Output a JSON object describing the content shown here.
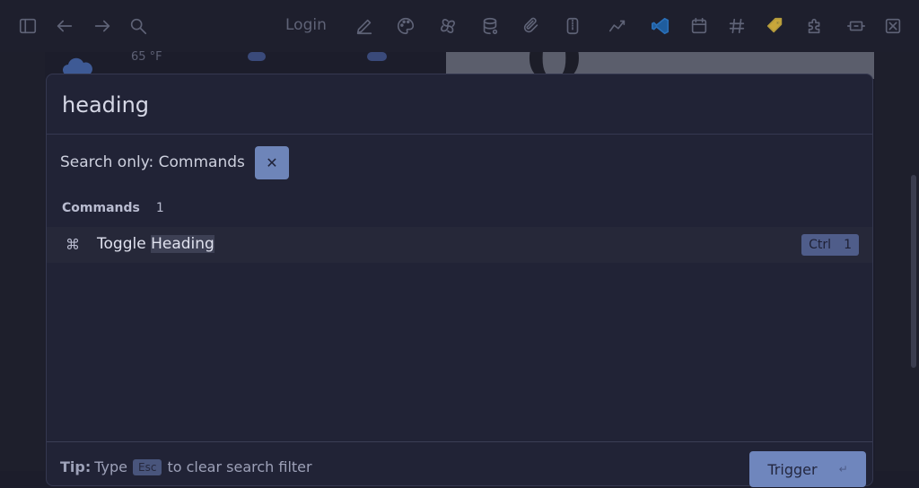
{
  "toolbar": {
    "login_label": "Login"
  },
  "background": {
    "weather_temp": "65 °F"
  },
  "palette": {
    "search_value": "heading",
    "search_placeholder": "",
    "filter_label": "Search only: Commands",
    "filter_clear_glyph": "✕",
    "group": {
      "name": "Commands",
      "count": "1"
    },
    "results": [
      {
        "icon_glyph": "⌘",
        "title_prefix": "Toggle ",
        "title_match": "Heading",
        "shortcut_mod": "Ctrl",
        "shortcut_key": "1"
      }
    ],
    "footer": {
      "tip_label": "Tip:",
      "tip_before": "Type",
      "tip_key": "Esc",
      "tip_after": "to clear search filter",
      "trigger_label": "Trigger",
      "trigger_glyph": "↵"
    }
  },
  "colors": {
    "accent": "#6f86bd",
    "background": "#1c1d2b",
    "modal": "#212336"
  }
}
